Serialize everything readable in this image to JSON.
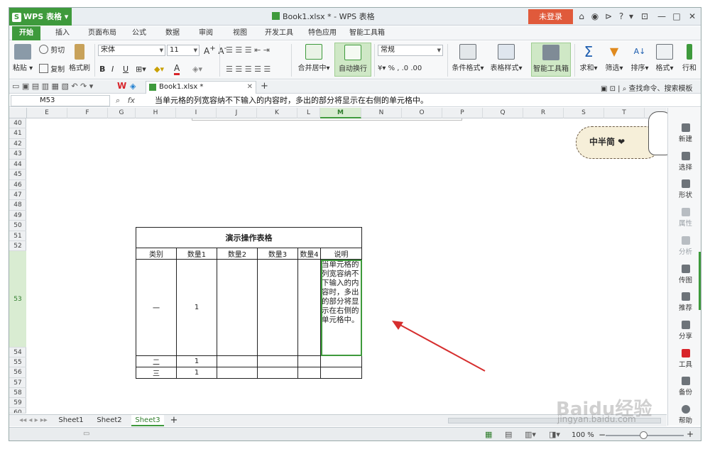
{
  "titlebar": {
    "app_button": "WPS 表格",
    "doc_title": "Book1.xlsx * - WPS 表格",
    "login": "未登录",
    "controls": [
      "⌂",
      "◉",
      "⊳",
      "?",
      "▾",
      "⊡",
      "—",
      "□",
      "✕"
    ]
  },
  "menu_tabs": [
    "开始",
    "插入",
    "页面布局",
    "公式",
    "数据",
    "审阅",
    "视图",
    "开发工具",
    "特色应用",
    "智能工具箱"
  ],
  "ribbon": {
    "paste": "粘贴",
    "cut": "剪切",
    "copy": "复制",
    "format_painter": "格式刷",
    "font_name": "宋体",
    "font_size": "11",
    "bold": "B",
    "italic": "I",
    "underline": "U",
    "merge_center": "合并居中",
    "wrap_text": "自动换行",
    "number_format": "常规",
    "percent": "%",
    "comma": ",",
    "cond_format": "条件格式",
    "table_style": "表格样式",
    "smart_toolbox": "智能工具箱",
    "sum": "求和",
    "filter": "筛选",
    "sort": "排序",
    "format": "格式",
    "row_col": "行和"
  },
  "quickbar": {
    "file_tab": "Book1.xlsx *",
    "find": "查找命令、搜索模板"
  },
  "formula_bar": {
    "name_box": "M53",
    "fx": "fx",
    "formula": "当单元格的列宽容纳不下输入的内容时，多出的部分将显示在右侧的单元格中。"
  },
  "columns": [
    "E",
    "F",
    "G",
    "H",
    "I",
    "J",
    "K",
    "L",
    "M",
    "N",
    "O",
    "P",
    "Q",
    "R",
    "S",
    "T"
  ],
  "rows": [
    "40",
    "41",
    "42",
    "43",
    "44",
    "45",
    "46",
    "47",
    "48",
    "49",
    "50",
    "51",
    "52",
    "53",
    "54",
    "55",
    "56",
    "57",
    "58",
    "59",
    "60"
  ],
  "table": {
    "title": "演示操作表格",
    "headers": [
      "类别",
      "数量1",
      "数量2",
      "数量3",
      "数量4",
      "说明"
    ],
    "rows": [
      {
        "cat": "一",
        "q1": "1",
        "note": "当单元格的列宽容纳不下输入的内容时，多出的部分将显示在右侧的单元格中。"
      },
      {
        "cat": "二",
        "q1": "1",
        "note": ""
      },
      {
        "cat": "三",
        "q1": "1",
        "note": ""
      }
    ]
  },
  "sticker": "中半简 ❤",
  "side_panel": [
    "新建",
    "选择",
    "形状",
    "属性",
    "分析",
    "传图",
    "推荐",
    "分享",
    "工具",
    "备份",
    "帮助"
  ],
  "sheets": [
    "Sheet1",
    "Sheet2",
    "Sheet3"
  ],
  "add_sheet": "+",
  "status": {
    "zoom": "100 %"
  },
  "watermark": "Baidu经验",
  "watermark_url": "jingyan.baidu.com",
  "colors": {
    "accent": "#3e9a3c",
    "login": "#e05a3b",
    "arrow": "#d62e2e"
  }
}
